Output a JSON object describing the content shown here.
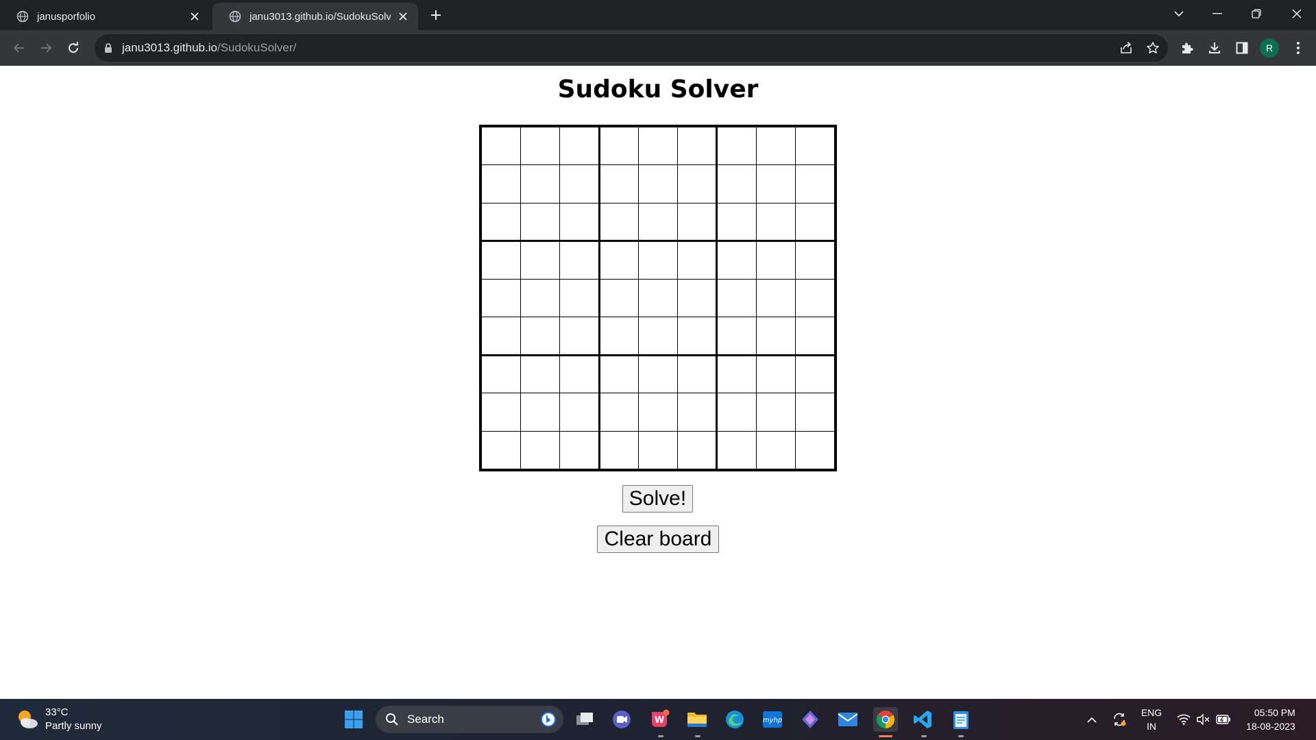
{
  "browser": {
    "tabs": [
      {
        "title": "janusporfolio",
        "active": false
      },
      {
        "title": "janu3013.github.io/SudokuSolver/",
        "active": true
      }
    ],
    "url": {
      "host": "janu3013.github.io",
      "path": "/SudokuSolver/"
    },
    "profile_initial": "R"
  },
  "page": {
    "title": "Sudoku Solver",
    "board": {
      "size": 9,
      "values": [
        [
          "",
          "",
          "",
          "",
          "",
          "",
          "",
          "",
          ""
        ],
        [
          "",
          "",
          "",
          "",
          "",
          "",
          "",
          "",
          ""
        ],
        [
          "",
          "",
          "",
          "",
          "",
          "",
          "",
          "",
          ""
        ],
        [
          "",
          "",
          "",
          "",
          "",
          "",
          "",
          "",
          ""
        ],
        [
          "",
          "",
          "",
          "",
          "",
          "",
          "",
          "",
          ""
        ],
        [
          "",
          "",
          "",
          "",
          "",
          "",
          "",
          "",
          ""
        ],
        [
          "",
          "",
          "",
          "",
          "",
          "",
          "",
          "",
          ""
        ],
        [
          "",
          "",
          "",
          "",
          "",
          "",
          "",
          "",
          ""
        ],
        [
          "",
          "",
          "",
          "",
          "",
          "",
          "",
          "",
          ""
        ]
      ]
    },
    "solve_label": "Solve!",
    "clear_label": "Clear board"
  },
  "taskbar": {
    "weather": {
      "temp": "33°C",
      "condition": "Partly sunny"
    },
    "search_placeholder": "Search",
    "lang_top": "ENG",
    "lang_bottom": "IN",
    "time": "05:50 PM",
    "date": "18-08-2023",
    "apps": [
      "windows-start",
      "task-view",
      "meet",
      "wps-office",
      "file-explorer",
      "edge",
      "myhp",
      "copilot",
      "mail",
      "chrome",
      "vscode",
      "notepad"
    ]
  },
  "colors": {
    "tabstrip_bg": "#202124",
    "toolbar_bg": "#35363a",
    "omnibox_bg": "#202124",
    "page_bg": "#ffffff",
    "button_bg": "#efefef",
    "profile_bg": "#0b6e4f"
  }
}
